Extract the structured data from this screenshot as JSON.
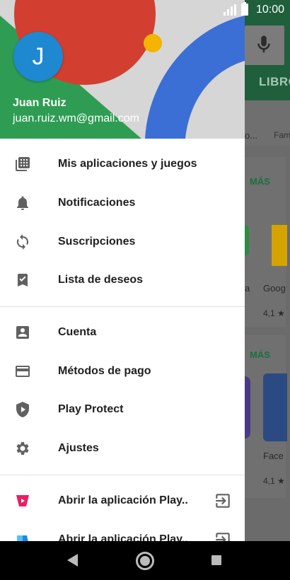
{
  "status_bar": {
    "time": "10:00"
  },
  "background": {
    "tab_label": "LIBRO",
    "more_label_1": "MÁS",
    "more_label_2": "MÁS",
    "partial_tab": "Fam",
    "partial_text_a": "o...",
    "app_name_1a": "a",
    "app_name_1b": "Goog",
    "rating_1": "4,1 ★",
    "app_name_2": "Face",
    "rating_2": "4,1 ★"
  },
  "drawer": {
    "avatar_initial": "J",
    "user_name": "Juan Ruiz",
    "user_email": "juan.ruiz.wm@gmail.com",
    "section1": [
      {
        "label": "Mis aplicaciones y juegos",
        "icon": "apps-grid-icon"
      },
      {
        "label": "Notificaciones",
        "icon": "bell-icon"
      },
      {
        "label": "Suscripciones",
        "icon": "refresh-icon"
      },
      {
        "label": "Lista de deseos",
        "icon": "bookmark-check-icon"
      }
    ],
    "section2": [
      {
        "label": "Cuenta",
        "icon": "account-box-icon"
      },
      {
        "label": "Métodos de pago",
        "icon": "credit-card-icon"
      },
      {
        "label": "Play Protect",
        "icon": "shield-play-icon"
      },
      {
        "label": "Ajustes",
        "icon": "gear-icon"
      }
    ],
    "section3": [
      {
        "label": "Abrir la aplicación Play..",
        "icon": "play-movies-icon"
      },
      {
        "label": "Abrir la aplicación Play..",
        "icon": "play-books-icon"
      }
    ]
  },
  "colors": {
    "avatar": "#1e88d0",
    "menu_icon": "#616161",
    "header_green": "#2e9d53",
    "header_red": "#d23f31",
    "header_blue": "#3b6fd6",
    "header_yellow": "#f4b400"
  }
}
